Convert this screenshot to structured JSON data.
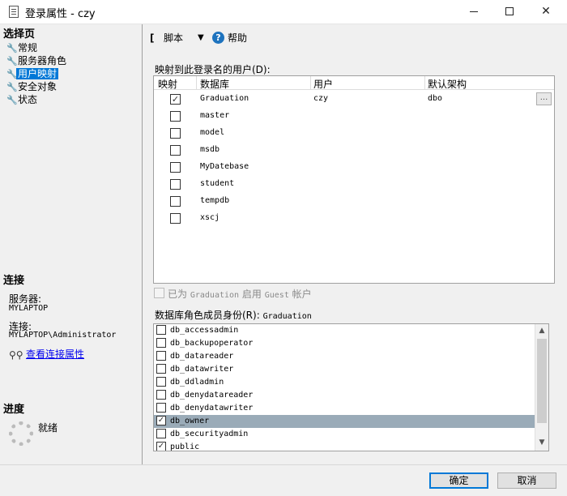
{
  "window": {
    "title": "登录属性 - czy",
    "minimize_glyph": "",
    "close_glyph": "✕"
  },
  "left_pane": {
    "select_page_heading": "选择页",
    "pages": [
      {
        "label": "常规",
        "icon": "wrench-icon"
      },
      {
        "label": "服务器角色",
        "icon": "wrench-icon"
      },
      {
        "label": "用户映射",
        "icon": "wrench-icon",
        "selected": true
      },
      {
        "label": "安全对象",
        "icon": "wrench-icon"
      },
      {
        "label": "状态",
        "icon": "wrench-icon"
      }
    ],
    "connection_heading": "连接",
    "server_label": "服务器:",
    "server_value": "MYLAPTOP",
    "connection_label": "连接:",
    "connection_value": "MYLAPTOP\\Administrator",
    "view_connection_link": "查看连接属性",
    "progress_heading": "进度",
    "progress_status": "就绪"
  },
  "toolbar": {
    "script_label": "脚本",
    "help_label": "帮助"
  },
  "user_mapping": {
    "section_label": "映射到此登录名的用户(D):",
    "columns": [
      "映射",
      "数据库",
      "用户",
      "默认架构"
    ],
    "rows": [
      {
        "mapped": true,
        "database": "Graduation",
        "user": "czy",
        "default_schema": "dbo"
      },
      {
        "mapped": false,
        "database": "master",
        "user": "",
        "default_schema": ""
      },
      {
        "mapped": false,
        "database": "model",
        "user": "",
        "default_schema": ""
      },
      {
        "mapped": false,
        "database": "msdb",
        "user": "",
        "default_schema": ""
      },
      {
        "mapped": false,
        "database": "MyDatebase",
        "user": "",
        "default_schema": ""
      },
      {
        "mapped": false,
        "database": "student",
        "user": "",
        "default_schema": ""
      },
      {
        "mapped": false,
        "database": "tempdb",
        "user": "",
        "default_schema": ""
      },
      {
        "mapped": false,
        "database": "xscj",
        "user": "",
        "default_schema": ""
      }
    ],
    "ellipsis_label": "..."
  },
  "guest": {
    "prefix": "已为",
    "database": "Graduation",
    "middle": "启用",
    "account": "Guest",
    "suffix": "帐户",
    "checked": false,
    "enabled": false
  },
  "roles": {
    "label_prefix": "数据库角色成员身份(R):",
    "database": "Graduation",
    "items": [
      {
        "name": "db_accessadmin",
        "checked": false
      },
      {
        "name": "db_backupoperator",
        "checked": false
      },
      {
        "name": "db_datareader",
        "checked": false
      },
      {
        "name": "db_datawriter",
        "checked": false
      },
      {
        "name": "db_ddladmin",
        "checked": false
      },
      {
        "name": "db_denydatareader",
        "checked": false
      },
      {
        "name": "db_denydatawriter",
        "checked": false
      },
      {
        "name": "db_owner",
        "checked": true,
        "selected": true
      },
      {
        "name": "db_securityadmin",
        "checked": false
      },
      {
        "name": "public",
        "checked": true
      }
    ]
  },
  "buttons": {
    "ok": "确定",
    "cancel": "取消"
  },
  "colors": {
    "selection_blue": "#0078d7",
    "role_selected": "#9aabb8",
    "link": "#0000ee"
  }
}
